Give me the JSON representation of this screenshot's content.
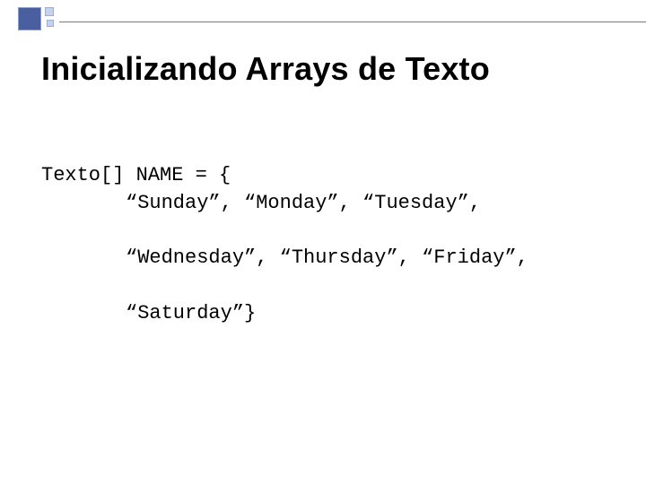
{
  "title": "Inicializando Arrays de Texto",
  "code": {
    "line1": "Texto[] NAME = {",
    "line2": "“Sunday”, “Monday”, “Tuesday”,",
    "line3": "“Wednesday”, “Thursday”, “Friday”,",
    "line4": "“Saturday”}"
  }
}
